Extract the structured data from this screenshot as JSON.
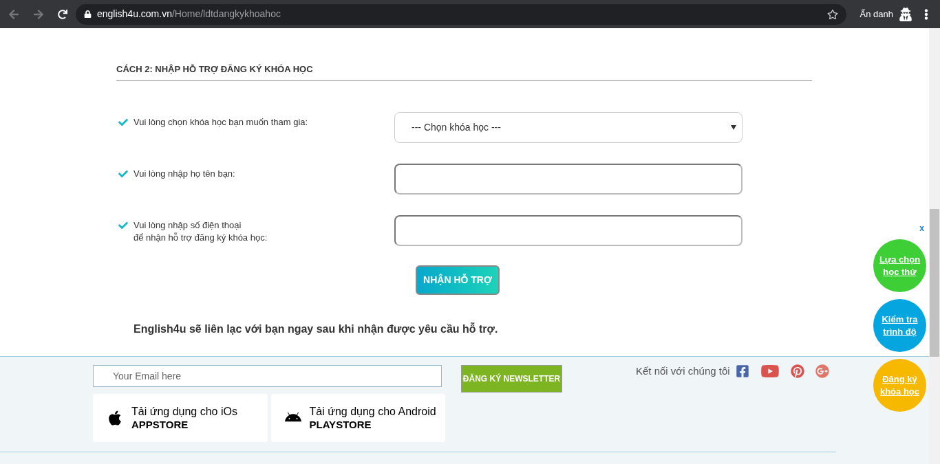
{
  "browser": {
    "url_host": "english4u.com.vn",
    "url_path": "/Home/ldtdangkykhoahoc",
    "profile_label": "Ẩn danh"
  },
  "form": {
    "title": "CÁCH 2: NHẬP HỖ TRỢ ĐĂNG KÝ KHÓA HỌC",
    "fields": [
      {
        "kind": "select",
        "label": [
          "Vui lòng chọn khóa học bạn muốn tham gia:"
        ],
        "value": "--- Chọn khóa học ---"
      },
      {
        "kind": "text",
        "label": [
          "Vui lòng nhập họ tên bạn:"
        ]
      },
      {
        "kind": "text",
        "label": [
          "Vui lòng nhập số điện thoại",
          "để nhận hỗ trợ đăng ký khóa học:"
        ]
      }
    ],
    "submit": "NHẬN HỖ TRỢ",
    "note": "English4u sẽ liên lạc với bạn ngay sau khi nhận được yêu cầu hỗ trợ."
  },
  "footer": {
    "email_placeholder": "Your Email here",
    "newsletter_button": "ĐĂNG KÝ NEWSLETTER",
    "connect_label": "Kết nối với chúng tôi",
    "apps": [
      {
        "kind": "ios",
        "line1": "Tải ứng dụng cho iOs",
        "line2": "APPSTORE"
      },
      {
        "kind": "android",
        "line1": "Tải ứng dụng cho Android",
        "line2": "PLAYSTORE"
      }
    ]
  },
  "floating": {
    "close": "x",
    "buttons": [
      {
        "lines": [
          "Lựa chọn",
          "học thử"
        ],
        "color": "#3dcf35"
      },
      {
        "lines": [
          "Kiểm tra",
          "trình độ"
        ],
        "color": "#05a6e0"
      },
      {
        "lines": [
          "Đăng ký",
          "khóa học"
        ],
        "color": "#f7b900"
      }
    ]
  }
}
